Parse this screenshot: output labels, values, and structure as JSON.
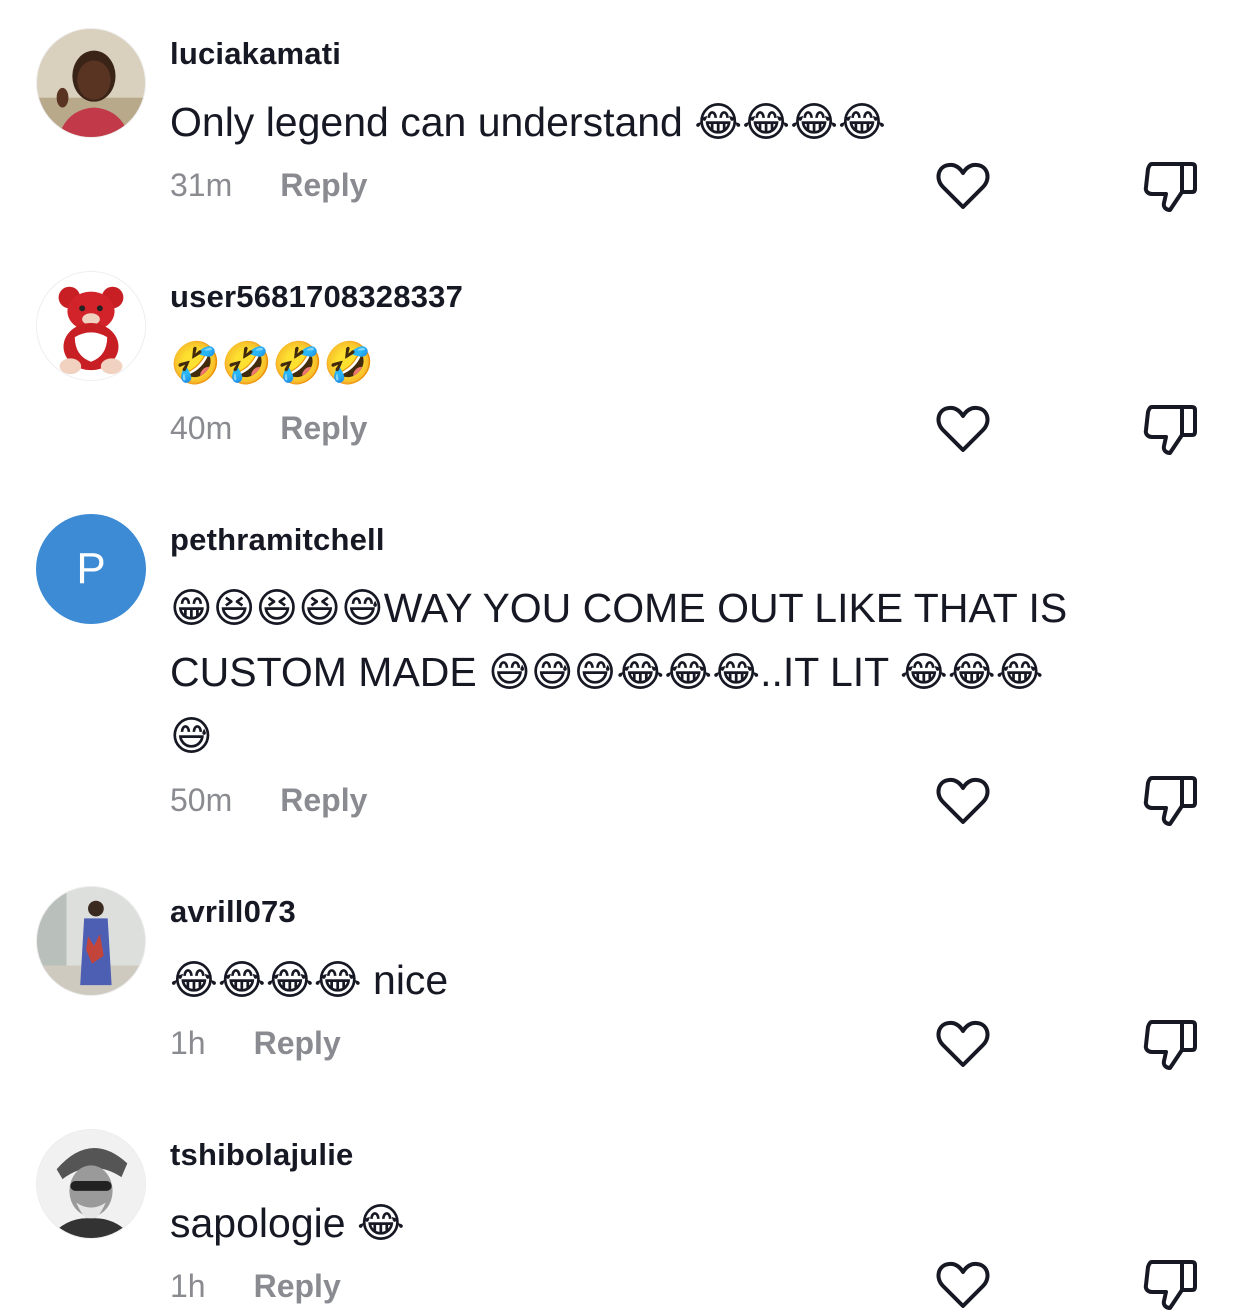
{
  "colors": {
    "text": "#161823",
    "meta": "#8a8b91",
    "letter_avatar": "#3d8bd4",
    "icon_stroke": "#161823"
  },
  "icons": {
    "like": "heart-outline-icon",
    "dislike": "thumbs-down-outline-icon"
  },
  "comments": [
    {
      "avatar": "photo",
      "username": "luciakamati",
      "text": "Only legend can understand 😂😂😂😂",
      "time": "31m",
      "reply": "Reply"
    },
    {
      "avatar": "photo",
      "username": "user5681708328337",
      "text": "🤣🤣🤣🤣",
      "time": "40m",
      "reply": "Reply"
    },
    {
      "avatar": "letter",
      "avatar_letter": "P",
      "username": "pethramitchell",
      "text": "😁😆😆😆😅WAY YOU COME OUT LIKE THAT IS CUSTOM MADE 😅😅😅😂😂😂..IT LIT 😂😂😂😅",
      "time": "50m",
      "reply": "Reply"
    },
    {
      "avatar": "photo",
      "username": "avrill073",
      "text": "😂😂😂😂 nice",
      "time": "1h",
      "reply": "Reply"
    },
    {
      "avatar": "photo",
      "username": "tshibolajulie",
      "text": "sapologie 😂",
      "time": "1h",
      "reply": "Reply"
    }
  ]
}
